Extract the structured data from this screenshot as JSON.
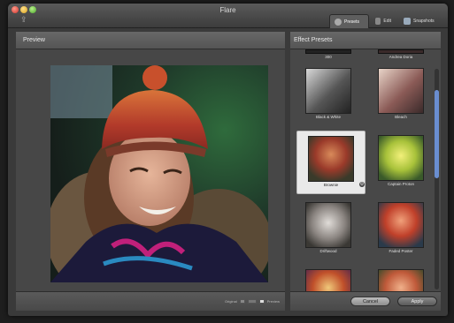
{
  "window": {
    "title": "Flare"
  },
  "tabs": [
    {
      "label": "Presets",
      "active": true
    },
    {
      "label": "Edit",
      "active": false
    },
    {
      "label": "Snapshots",
      "active": false
    }
  ],
  "preview": {
    "header": "Preview",
    "footer": {
      "original_label": "Original",
      "preview_label": "Preview"
    }
  },
  "presets": {
    "header": "Effect Presets",
    "top_labels": [
      "300",
      "Andrea Doria"
    ],
    "items": [
      {
        "label": "Black & White",
        "selected": false
      },
      {
        "label": "Bleach",
        "selected": false
      },
      {
        "label": "Brownie",
        "selected": true
      },
      {
        "label": "Captain Proton",
        "selected": false
      },
      {
        "label": "Driftwood",
        "selected": false
      },
      {
        "label": "Faded Poster",
        "selected": false
      },
      {
        "label": "",
        "selected": false
      },
      {
        "label": "",
        "selected": false
      }
    ]
  },
  "buttons": {
    "cancel": "Cancel",
    "apply": "Apply"
  },
  "icons": {
    "close": "close-icon",
    "minimize": "minimize-icon",
    "maximize": "maximize-icon",
    "share": "share-icon",
    "presets": "presets-icon",
    "edit": "edit-icon",
    "snapshots": "snapshots-icon",
    "gear": "gear-icon"
  }
}
